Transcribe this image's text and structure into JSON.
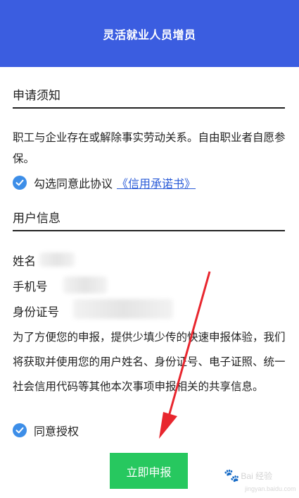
{
  "header": {
    "title": "灵活就业人员增员"
  },
  "notice": {
    "title": "申请须知",
    "text": "职工与企业存在或解除事实劳动关系。自由职业者自愿参保。",
    "agree_label": "勾选同意此协议",
    "agreement_link": "《信用承诺书》"
  },
  "user_info": {
    "title": "用户信息",
    "name_label": "姓名",
    "phone_label": "手机号",
    "id_label": "身份证号",
    "disclaimer": "为了方便您的申报，提供少填少传的快速申报体验，我们将获取并使用您的用户姓名、身份证号、电子证照、统一社会信用代码等其他本次事项申报相关的共享信息。",
    "authorize_label": "同意授权"
  },
  "actions": {
    "submit_label": "立即申报"
  },
  "watermark": {
    "brand": "Bai 经验",
    "url": "jingyan.baidu.com"
  },
  "colors": {
    "header": "#3b5de0",
    "submit": "#27c85f",
    "check": "#3d8ee8",
    "annotation": "#e8262e"
  }
}
